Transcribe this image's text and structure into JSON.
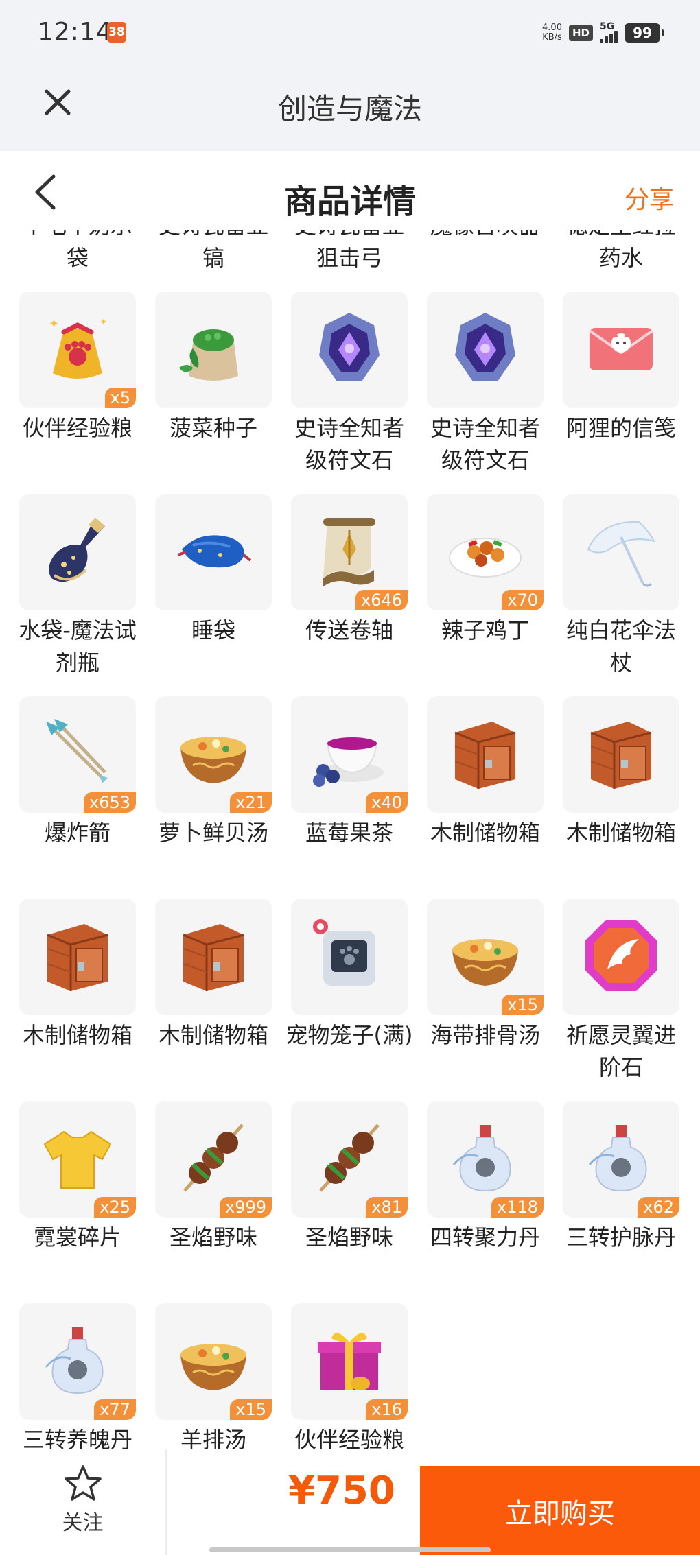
{
  "status_bar": {
    "time": "12:14",
    "app_badge": "38",
    "net_speed_value": "4.00",
    "net_speed_unit": "KB/s",
    "hd": "HD",
    "network": "5G",
    "battery": "99"
  },
  "app_header": {
    "title": "创造与魔法",
    "close_icon": "close-icon"
  },
  "nav": {
    "title": "商品详情",
    "share_label": "分享",
    "back_icon": "chevron-left-icon"
  },
  "items": [
    {
      "name": "羊毛牛奶示袋",
      "qty": "",
      "icon": "bag-icon"
    },
    {
      "name": "史诗瓦雷亚镐",
      "qty": "",
      "icon": "pickaxe-icon"
    },
    {
      "name": "史诗瓦雷亚狙击弓",
      "qty": "",
      "icon": "bow-icon"
    },
    {
      "name": "魔像召唤器",
      "qty": "",
      "icon": "summoner-icon"
    },
    {
      "name": "稳定生红拉药水",
      "qty": "",
      "icon": "potion-icon"
    },
    {
      "name": "伙伴经验粮",
      "qty": "x5",
      "icon": "pet-food-bag-icon"
    },
    {
      "name": "菠菜种子",
      "qty": "",
      "icon": "seed-sack-icon"
    },
    {
      "name": "史诗全知者级符文石",
      "qty": "",
      "icon": "rune-stone-icon"
    },
    {
      "name": "史诗全知者级符文石",
      "qty": "",
      "icon": "rune-stone-icon"
    },
    {
      "name": "阿狸的信笺",
      "qty": "",
      "icon": "letter-icon"
    },
    {
      "name": "水袋-魔法试剂瓶",
      "qty": "",
      "icon": "potion-flask-icon"
    },
    {
      "name": "睡袋",
      "qty": "",
      "icon": "sleeping-bag-icon"
    },
    {
      "name": "传送卷轴",
      "qty": "x646",
      "icon": "scroll-icon"
    },
    {
      "name": "辣子鸡丁",
      "qty": "x70",
      "icon": "dish-icon"
    },
    {
      "name": "纯白花伞法杖",
      "qty": "",
      "icon": "umbrella-icon"
    },
    {
      "name": "爆炸箭",
      "qty": "x653",
      "icon": "arrow-icon"
    },
    {
      "name": "萝卜鲜贝汤",
      "qty": "x21",
      "icon": "soup-icon"
    },
    {
      "name": "蓝莓果茶",
      "qty": "x40",
      "icon": "tea-cup-icon"
    },
    {
      "name": "木制储物箱",
      "qty": "",
      "icon": "wooden-box-icon"
    },
    {
      "name": "木制储物箱",
      "qty": "",
      "icon": "wooden-box-icon"
    },
    {
      "name": "木制储物箱",
      "qty": "",
      "icon": "wooden-box-icon"
    },
    {
      "name": "木制储物箱",
      "qty": "",
      "icon": "wooden-box-icon"
    },
    {
      "name": "宠物笼子(满)",
      "qty": "",
      "icon": "pet-cage-icon"
    },
    {
      "name": "海带排骨汤",
      "qty": "x15",
      "icon": "soup-icon"
    },
    {
      "name": "祈愿灵翼进阶石",
      "qty": "",
      "icon": "wing-gem-icon"
    },
    {
      "name": "霓裳碎片",
      "qty": "x25",
      "icon": "shirt-icon"
    },
    {
      "name": "圣焰野味",
      "qty": "x999",
      "icon": "skewer-icon"
    },
    {
      "name": "圣焰野味",
      "qty": "x81",
      "icon": "skewer-icon"
    },
    {
      "name": "四转聚力丹",
      "qty": "x118",
      "icon": "elixir-bottle-icon"
    },
    {
      "name": "三转护脉丹",
      "qty": "x62",
      "icon": "elixir-bottle-icon"
    },
    {
      "name": "三转养魄丹",
      "qty": "x77",
      "icon": "elixir-bottle-icon"
    },
    {
      "name": "羊排汤",
      "qty": "x15",
      "icon": "soup-icon"
    },
    {
      "name": "伙伴经验粮礼包",
      "qty": "x16",
      "icon": "gift-box-icon"
    }
  ],
  "bottom_bar": {
    "follow_label": "关注",
    "price": "¥750",
    "buy_label": "立即购买",
    "follow_icon": "star-icon"
  },
  "colors": {
    "accent": "#fb5a0a",
    "price": "#f35a0a",
    "qty_badge": "#f3903a",
    "share": "#e8731a",
    "header_bg": "#f1f3f6",
    "tile_bg": "#f5f5f5"
  }
}
